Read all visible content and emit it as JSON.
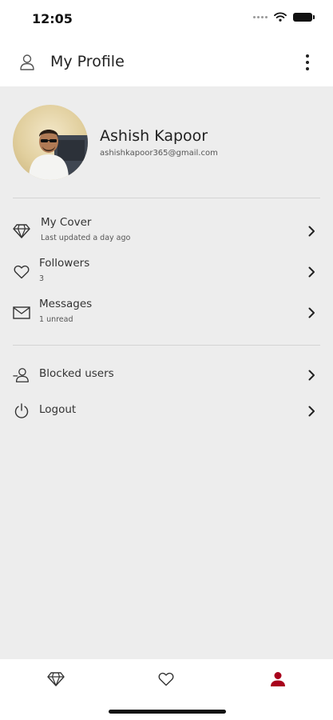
{
  "status_bar": {
    "time": "12:05"
  },
  "app_bar": {
    "title": "My Profile"
  },
  "profile": {
    "name": "Ashish Kapoor",
    "email": "ashishkapoor365@gmail.com"
  },
  "menu": {
    "my_cover": {
      "label": "My Cover",
      "sub": "Last updated a day ago",
      "icon": "diamond-icon"
    },
    "followers": {
      "label": "Followers",
      "sub": "3",
      "icon": "heart-icon"
    },
    "messages": {
      "label": "Messages",
      "sub": "1 unread",
      "icon": "envelope-icon"
    },
    "blocked": {
      "label": "Blocked users",
      "icon": "user-minus-icon"
    },
    "logout": {
      "label": "Logout",
      "icon": "power-icon"
    }
  },
  "bottom_nav": {
    "active": "profile",
    "accent_color": "#a8001c",
    "items": [
      "diamond-icon",
      "heart-icon",
      "person-icon"
    ]
  }
}
